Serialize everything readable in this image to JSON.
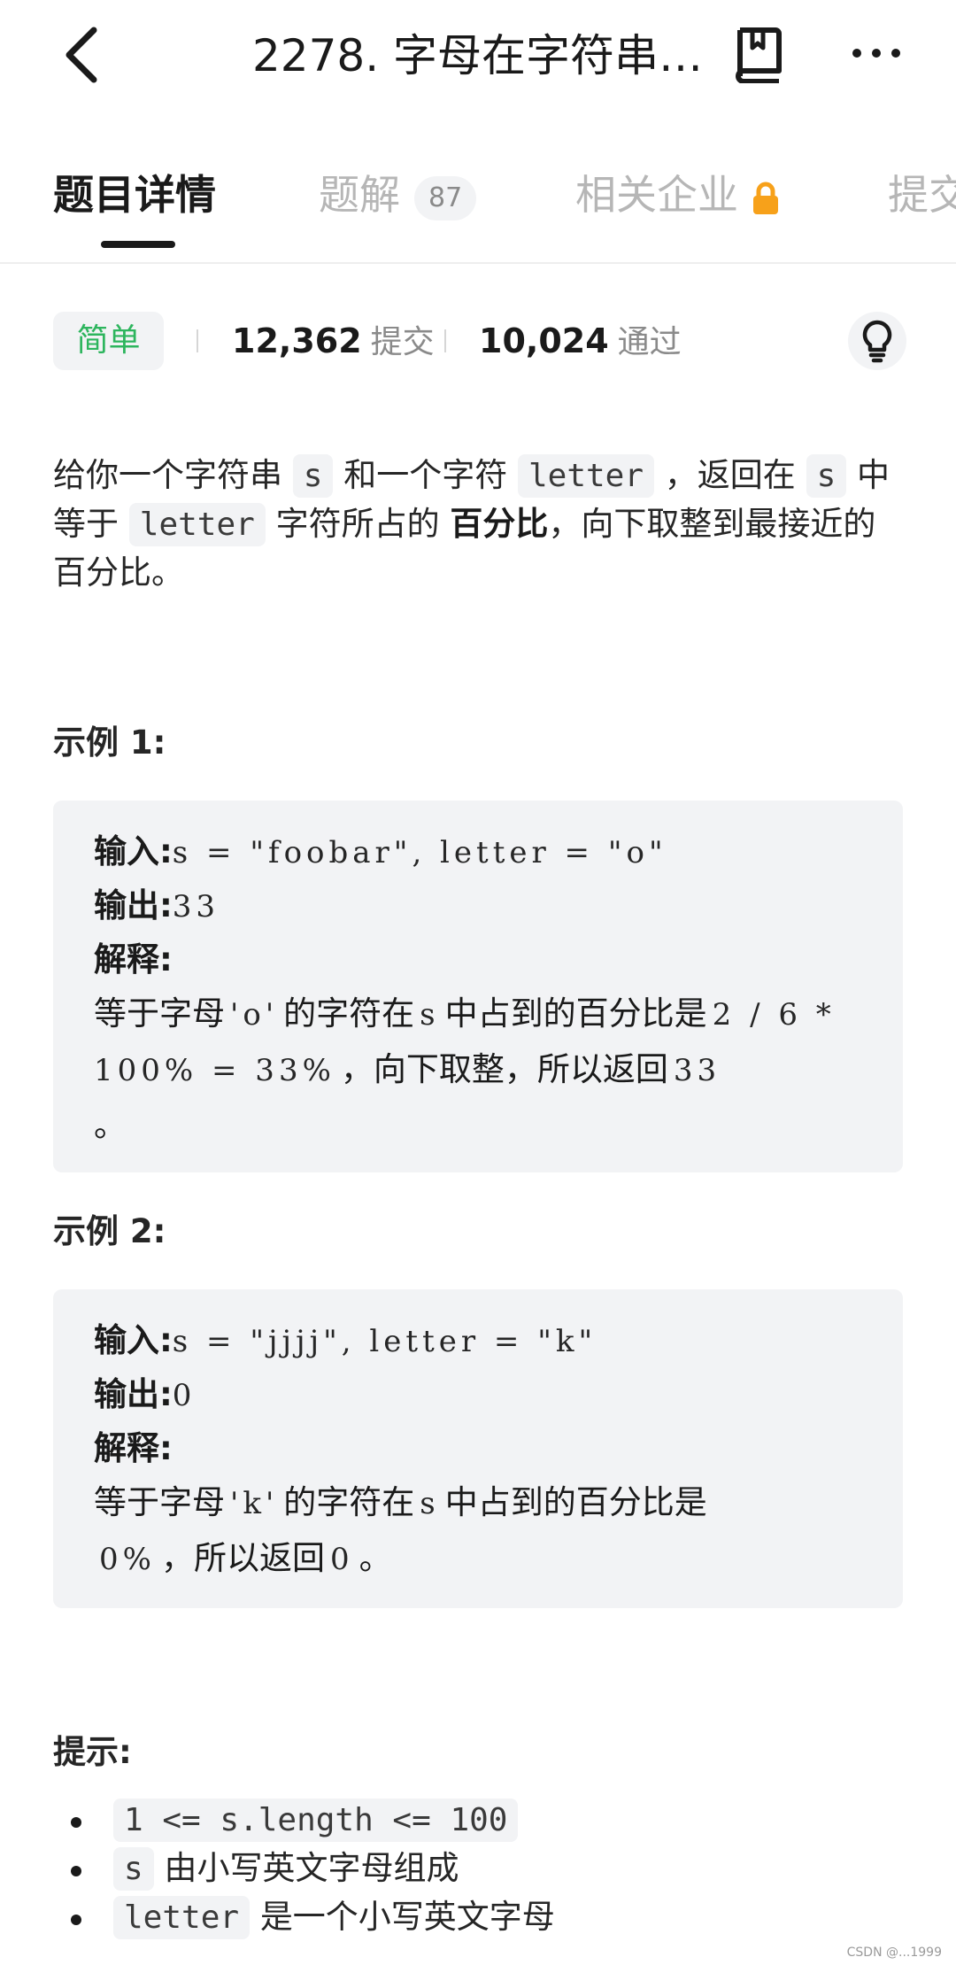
{
  "header": {
    "title": "2278. 字母在字符串…",
    "back_icon": "chevron-left-icon",
    "book_icon": "book-icon",
    "more_icon": "more-icon"
  },
  "tabs": [
    {
      "label": "题目详情",
      "active": true
    },
    {
      "label": "题解",
      "badge": "87"
    },
    {
      "label": "相关企业",
      "icon": "lock-icon"
    },
    {
      "label": "提交"
    }
  ],
  "stats": {
    "difficulty": "简单",
    "submissions": "12,362",
    "submissions_label": "提交",
    "accepted": "10,024",
    "accepted_label": "通过"
  },
  "description": {
    "p1": "给你一个字符串",
    "code1": "s",
    "p2": "和一个字符",
    "code2": "letter",
    "p3": "，返回在",
    "code3": "s",
    "p4": "中等于",
    "code4": "letter",
    "p5": "字符所占的",
    "bold": "百分比",
    "p6": "，向下取整到最接近的百分比。"
  },
  "examples": [
    {
      "title": "示例 1:",
      "input_label": "输入:",
      "input_value": "s = \"foobar\", letter = \"o\"",
      "output_label": "输出:",
      "output_value": "33",
      "explain_label": "解释:",
      "e1": "等于字母",
      "m1": "'o'",
      "e2": "的字符在",
      "m2": "s",
      "e3": "中占到的百分比是",
      "m3": "2 / 6 * 100% = 33%",
      "e4": "，向下取整，所以返回",
      "m4": "33",
      "e5": "。"
    },
    {
      "title": "示例 2:",
      "input_label": "输入:",
      "input_value": "s = \"jjjj\", letter = \"k\"",
      "output_label": "输出:",
      "output_value": "0",
      "explain_label": "解释:",
      "e1": "等于字母",
      "m1": "'k'",
      "e2": "的字符在",
      "m2": "s",
      "e3": "中占到的百分比是",
      "m3": "0%",
      "e4": "，所以返回",
      "m4": "0",
      "e5": "。"
    }
  ],
  "tips": {
    "title": "提示:",
    "items": [
      {
        "code": "1 <= s.length <= 100",
        "text": ""
      },
      {
        "code": "s",
        "text": "由小写英文字母组成"
      },
      {
        "code": "letter",
        "text": "是一个小写英文字母"
      }
    ]
  },
  "watermark": "CSDN @...1999"
}
